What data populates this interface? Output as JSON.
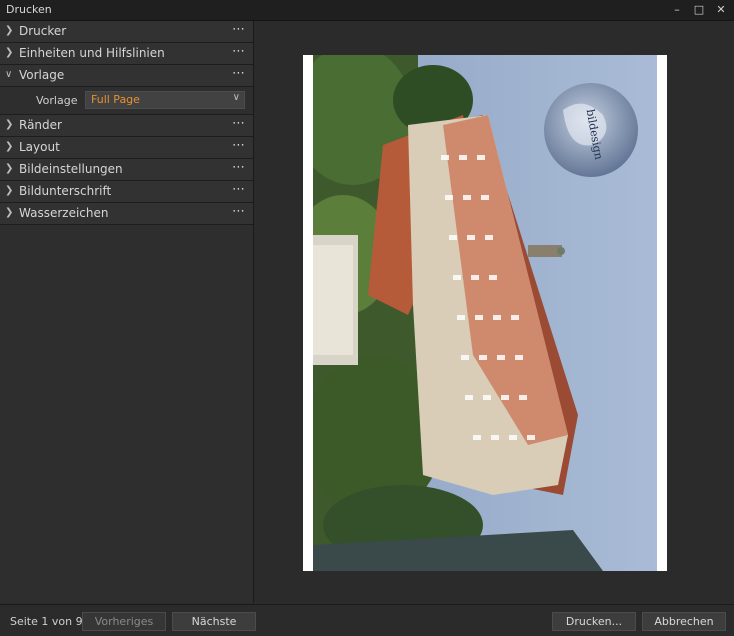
{
  "window": {
    "title": "Drucken"
  },
  "window_controls": {
    "minimize": "–",
    "maximize": "□",
    "close": "✕"
  },
  "sidebar": {
    "sections": [
      {
        "label": "Drucker",
        "expanded": false
      },
      {
        "label": "Einheiten und Hilfslinien",
        "expanded": false
      },
      {
        "label": "Vorlage",
        "expanded": true,
        "fields": [
          {
            "label": "Vorlage",
            "value": "Full Page"
          }
        ]
      },
      {
        "label": "Ränder",
        "expanded": false
      },
      {
        "label": "Layout",
        "expanded": false
      },
      {
        "label": "Bildeinstellungen",
        "expanded": false
      },
      {
        "label": "Bildunterschrift",
        "expanded": false
      },
      {
        "label": "Wasserzeichen",
        "expanded": false
      }
    ],
    "more_glyph": "⋯"
  },
  "preview": {
    "watermark_text": "bildesign"
  },
  "footer": {
    "page_status": "Seite 1 von 9",
    "prev_label": "Vorheriges",
    "next_label": "Nächste",
    "print_label": "Drucken...",
    "cancel_label": "Abbrechen"
  },
  "colors": {
    "accent": "#e8902f",
    "background": "#2b2b2b",
    "panel": "#323232"
  }
}
